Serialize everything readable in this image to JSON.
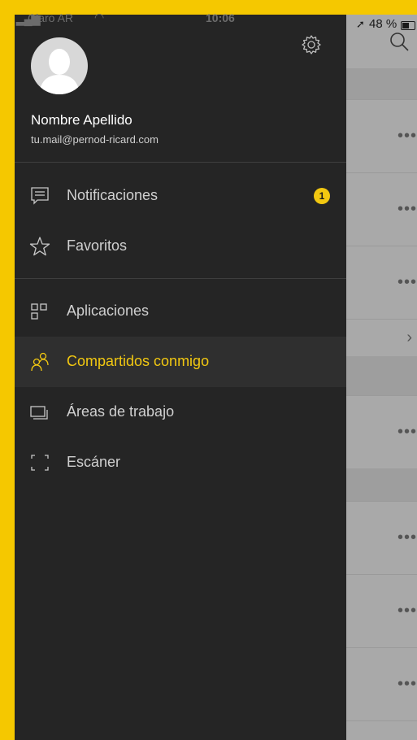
{
  "status": {
    "carrier": "Claro AR",
    "time": "10:06",
    "battery": "48 %"
  },
  "user": {
    "name": "Nombre Apellido",
    "email": "tu.mail@pernod-ricard.com"
  },
  "menu": {
    "notifications": {
      "label": "Notificaciones",
      "badge": "1",
      "icon": "notifications-icon"
    },
    "favorites": {
      "label": "Favoritos",
      "icon": "star-icon"
    },
    "apps": {
      "label": "Aplicaciones",
      "icon": "apps-icon"
    },
    "shared": {
      "label": "Compartidos conmigo",
      "icon": "people-icon",
      "active": true
    },
    "workspaces": {
      "label": "Áreas de trabajo",
      "icon": "workspaces-icon"
    },
    "scanner": {
      "label": "Escáner",
      "icon": "scanner-icon"
    }
  },
  "colors": {
    "accent": "#f2c811",
    "drawer": "#252525",
    "frame": "#f5c800"
  }
}
